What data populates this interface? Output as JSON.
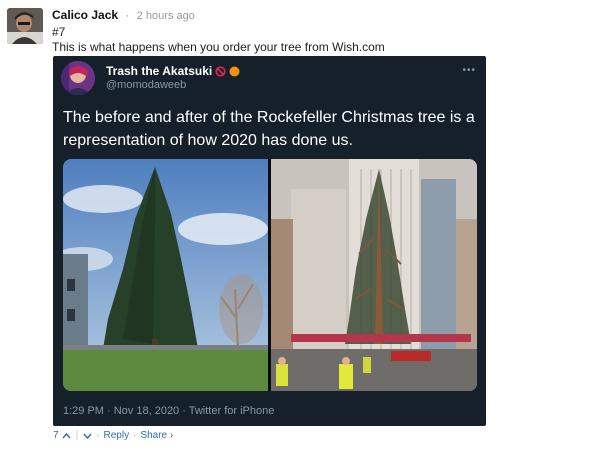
{
  "comment": {
    "author": "Calico Jack",
    "separator": "·",
    "time": "2 hours ago",
    "number": "#7",
    "message": "This is what happens when you order your tree from Wish.com",
    "avatar_icon": "user-avatar"
  },
  "tweet": {
    "display_name": "Trash the Akatsuki",
    "handle": "@momodaweeb",
    "text": "The before and after of the Rockefeller Christmas tree is a representation of how 2020 has done us.",
    "footer": "1:29 PM · Nov 18, 2020 · Twitter for iPhone",
    "more_icon": "more-dots-icon",
    "badge_icons": [
      "prohibited-icon",
      "orange-circle-icon"
    ],
    "photos": [
      "before-tree-photo",
      "after-tree-photo"
    ]
  },
  "actions": {
    "score": "7",
    "upvote_icon": "chevron-up-icon",
    "downvote_icon": "chevron-down-icon",
    "dot": "·",
    "reply_label": "Reply",
    "share_label": "Share ›"
  },
  "colors": {
    "tweet_bg": "#15202b",
    "tweet_text": "#ffffff",
    "tweet_muted": "#8899a6",
    "link_blue": "#2a6ebb"
  }
}
